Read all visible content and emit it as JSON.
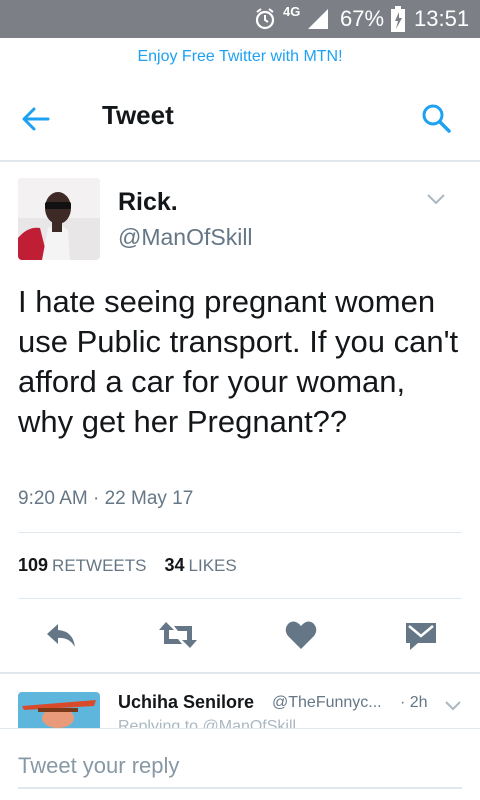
{
  "status_bar": {
    "network": "4G",
    "battery_percent": "67%",
    "time": "13:51",
    "icons": [
      "alarm-icon",
      "signal-icon",
      "battery-charging-icon"
    ]
  },
  "promo": {
    "text": "Enjoy Free Twitter with MTN!"
  },
  "header": {
    "title": "Tweet",
    "icons": [
      "back-arrow-icon",
      "search-icon"
    ]
  },
  "tweet": {
    "author_name": "Rick.",
    "author_handle": "@ManOfSkill",
    "text": "I hate seeing pregnant women use Public transport. If you can't afford a car for your woman, why get her Pregnant??",
    "timestamp": "9:20 AM · 22 May 17",
    "retweets_count": "109",
    "retweets_label": "RETWEETS",
    "likes_count": "34",
    "likes_label": "LIKES"
  },
  "actions": [
    "reply-icon",
    "retweet-icon",
    "like-icon",
    "direct-message-icon"
  ],
  "reply_preview": {
    "name": "Uchiha Senilore",
    "handle": "@TheFunnyc...",
    "time": "· 2h",
    "subtext": "Replying to @ManOfSkill"
  },
  "reply_box": {
    "placeholder": "Tweet your reply"
  },
  "colors": {
    "accent": "#1da1f2",
    "icon_gray": "#657786",
    "status_bar": "#7c8086",
    "divider": "#e1e8ed"
  }
}
